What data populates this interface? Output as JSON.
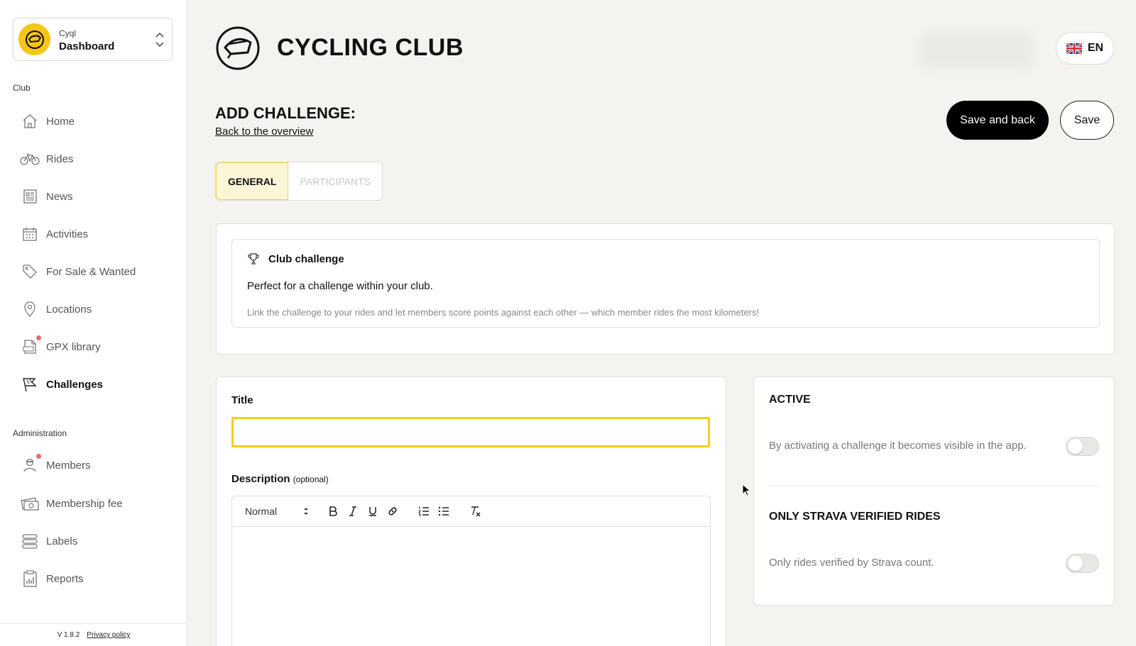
{
  "sidebar": {
    "switcher": {
      "app": "Cyql",
      "name": "Dashboard"
    },
    "club_label": "Club",
    "admin_label": "Administration",
    "club_items": [
      {
        "label": "Home",
        "icon": "home-icon"
      },
      {
        "label": "Rides",
        "icon": "bicycle-icon"
      },
      {
        "label": "News",
        "icon": "newspaper-icon"
      },
      {
        "label": "Activities",
        "icon": "calendar-icon"
      },
      {
        "label": "For Sale & Wanted",
        "icon": "tag-icon"
      },
      {
        "label": "Locations",
        "icon": "map-pin-icon"
      },
      {
        "label": "GPX library",
        "icon": "gpx-file-icon",
        "notification": true
      },
      {
        "label": "Challenges",
        "icon": "flag-icon",
        "active": true
      }
    ],
    "admin_items": [
      {
        "label": "Members",
        "icon": "member-icon",
        "notification": true
      },
      {
        "label": "Membership fee",
        "icon": "money-icon"
      },
      {
        "label": "Labels",
        "icon": "labels-icon"
      },
      {
        "label": "Reports",
        "icon": "clipboard-icon"
      }
    ],
    "footer": {
      "version": "V 1.8.2",
      "privacy": "Privacy policy"
    }
  },
  "header": {
    "brand": "CYCLING CLUB",
    "lang": "EN"
  },
  "page": {
    "title": "ADD CHALLENGE:",
    "back": "Back to the overview",
    "save_back": "Save and back",
    "save": "Save"
  },
  "tabs": [
    {
      "label": "GENERAL"
    },
    {
      "label": "PARTICIPANTS"
    }
  ],
  "challenge_type": {
    "title": "Club challenge",
    "desc": "Perfect for a challenge within your club.",
    "detail": "Link the challenge to your rides and let members score points against each other — which member rides the most kilometers!"
  },
  "form": {
    "title_label": "Title",
    "title_value": "",
    "description_label": "Description",
    "description_optional": "(optional)",
    "editor_format": "Normal"
  },
  "settings": {
    "active_title": "ACTIVE",
    "active_desc": "By activating a challenge it becomes visible in the app.",
    "active_on": false,
    "strava_title": "ONLY STRAVA VERIFIED RIDES",
    "strava_desc": "Only rides verified by Strava count.",
    "strava_on": false
  },
  "colors": {
    "accent": "#f2cf1b",
    "dark": "#000000",
    "notification": "#e96a6a"
  }
}
